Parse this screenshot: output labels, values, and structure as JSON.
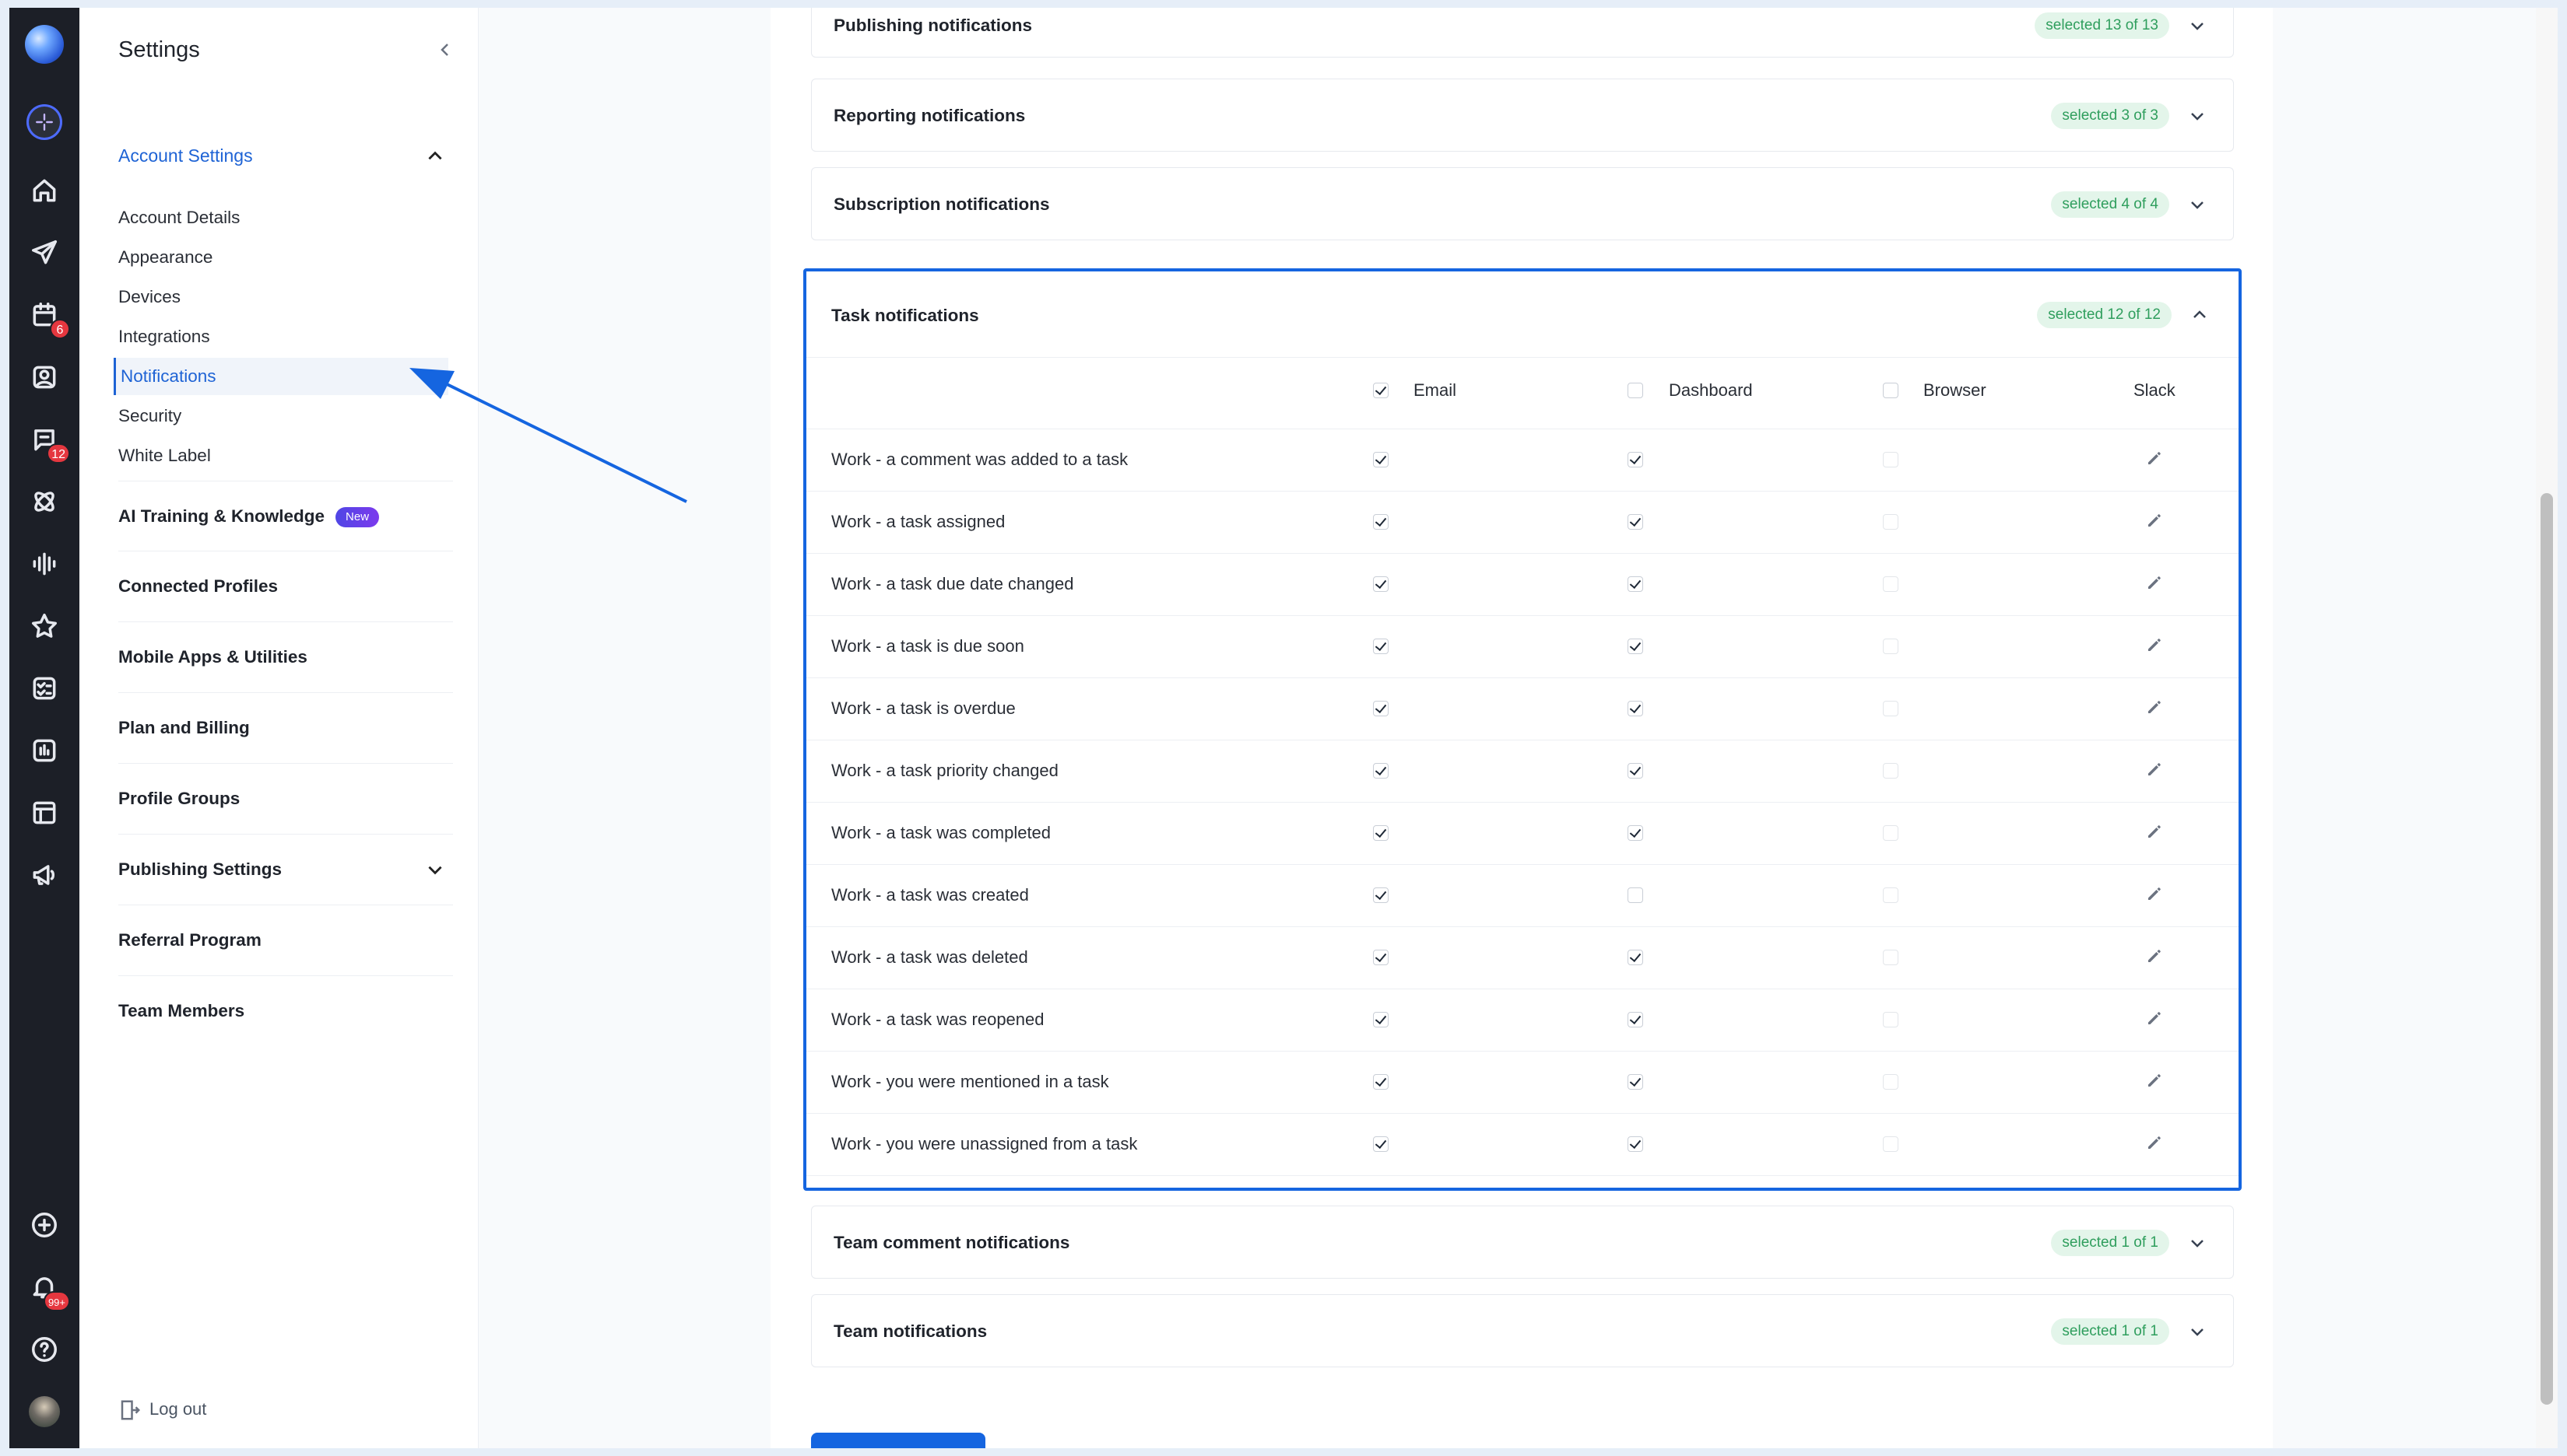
{
  "rail": {
    "badges": {
      "calendar": "6",
      "inbox": "12",
      "notifications": "99+"
    }
  },
  "sidebar": {
    "title": "Settings",
    "account_group": "Account Settings",
    "account_items": [
      "Account Details",
      "Appearance",
      "Devices",
      "Integrations",
      "Notifications",
      "Security",
      "White Label"
    ],
    "sections": {
      "ai": "AI Training & Knowledge",
      "ai_badge": "New",
      "connected": "Connected Profiles",
      "mobile": "Mobile Apps & Utilities",
      "plan": "Plan and Billing",
      "profile_groups": "Profile Groups",
      "publishing": "Publishing Settings",
      "referral": "Referral Program",
      "team": "Team Members"
    },
    "logout": "Log out"
  },
  "accordions": {
    "publishing": {
      "title": "Publishing notifications",
      "badge": "selected 13 of 13"
    },
    "reporting": {
      "title": "Reporting notifications",
      "badge": "selected 3 of 3"
    },
    "subscription": {
      "title": "Subscription notifications",
      "badge": "selected 4 of 4"
    },
    "team_comment": {
      "title": "Team comment notifications",
      "badge": "selected 1 of 1"
    },
    "team": {
      "title": "Team notifications",
      "badge": "selected 1 of 1"
    }
  },
  "task": {
    "title": "Task notifications",
    "badge": "selected 12 of 12",
    "columns": {
      "email": "Email",
      "dashboard": "Dashboard",
      "browser": "Browser",
      "slack": "Slack"
    },
    "header_checks": {
      "email": true,
      "dashboard": false,
      "browser": false
    },
    "rows": [
      {
        "label": "Work - a comment was added to a task",
        "email": true,
        "dashboard": true,
        "browser": false
      },
      {
        "label": "Work - a task assigned",
        "email": true,
        "dashboard": true,
        "browser": false
      },
      {
        "label": "Work - a task due date changed",
        "email": true,
        "dashboard": true,
        "browser": false
      },
      {
        "label": "Work - a task is due soon",
        "email": true,
        "dashboard": true,
        "browser": false
      },
      {
        "label": "Work - a task is overdue",
        "email": true,
        "dashboard": true,
        "browser": false
      },
      {
        "label": "Work - a task priority changed",
        "email": true,
        "dashboard": true,
        "browser": false
      },
      {
        "label": "Work - a task was completed",
        "email": true,
        "dashboard": true,
        "browser": false
      },
      {
        "label": "Work - a task was created",
        "email": true,
        "dashboard": false,
        "browser": false
      },
      {
        "label": "Work - a task was deleted",
        "email": true,
        "dashboard": true,
        "browser": false
      },
      {
        "label": "Work - a task was reopened",
        "email": true,
        "dashboard": true,
        "browser": false
      },
      {
        "label": "Work - you were mentioned in a task",
        "email": true,
        "dashboard": true,
        "browser": false
      },
      {
        "label": "Work - you were unassigned from a task",
        "email": true,
        "dashboard": true,
        "browser": false
      }
    ]
  },
  "colors": {
    "accent": "#1565e0",
    "badge_bg": "#e3f5ea",
    "badge_text": "#2f9e5d",
    "rail": "#1c1f27"
  }
}
